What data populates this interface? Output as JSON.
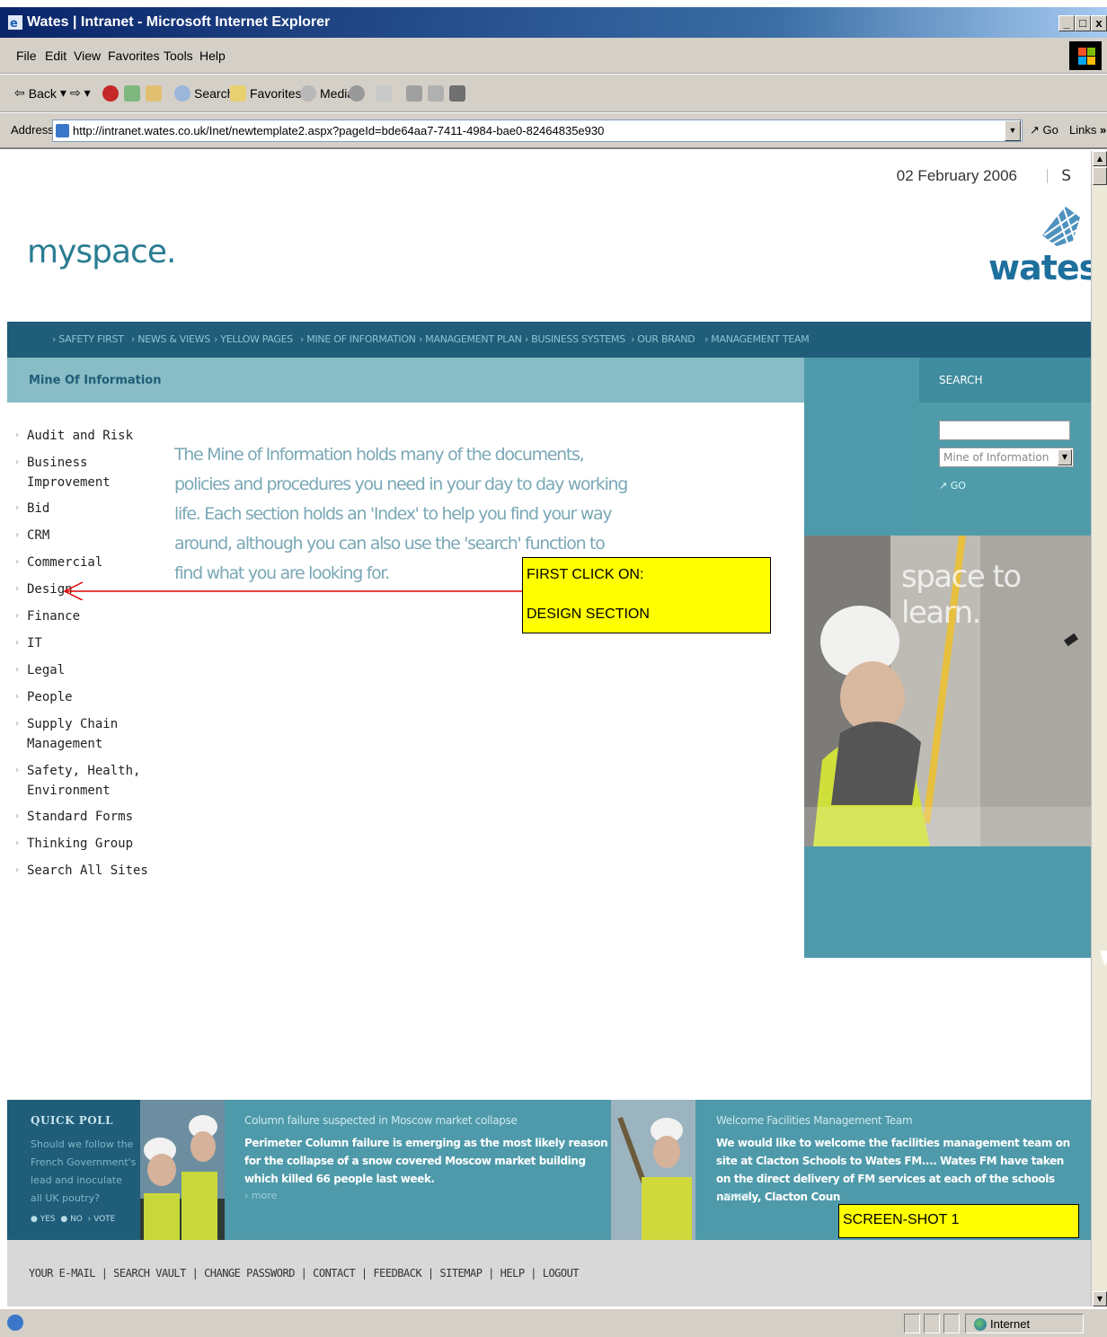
{
  "window": {
    "title": "Wates | Intranet - Microsoft Internet Explorer",
    "controls": [
      "_",
      "□",
      "x"
    ]
  },
  "menu": [
    "File",
    "Edit",
    "View",
    "Favorites",
    "Tools",
    "Help"
  ],
  "toolbar": {
    "back": "Back",
    "search": "Search",
    "favorites": "Favorites",
    "media": "Media"
  },
  "address": {
    "label": "Address",
    "url": "http://intranet.wates.co.uk/Inet/newtemplate2.aspx?pageId=bde64aa7-7411-4984-bae0-82464835e930",
    "go": "Go",
    "links": "Links"
  },
  "header": {
    "date": "02 February 2006",
    "s": "S",
    "logo_left": "myspace.",
    "logo_right": "wates"
  },
  "nav": [
    "› SAFETY FIRST",
    "› NEWS & VIEWS",
    "› YELLOW PAGES",
    "› MINE OF INFORMATION",
    "› MANAGEMENT PLAN",
    "› BUSINESS SYSTEMS",
    "› OUR BRAND",
    "› MANAGEMENT TEAM"
  ],
  "section": {
    "title": "Mine Of Information"
  },
  "search": {
    "label": "SEARCH",
    "input_value": "",
    "scope": "Mine of Information",
    "go": "GO"
  },
  "hero": {
    "text": "space to learn."
  },
  "sidebar": [
    {
      "label": "Audit and Risk",
      "label2": ""
    },
    {
      "label": "Business",
      "label2": "Improvement"
    },
    {
      "label": "Bid",
      "label2": ""
    },
    {
      "label": "CRM",
      "label2": ""
    },
    {
      "label": "Commercial",
      "label2": ""
    },
    {
      "label": "Design",
      "label2": ""
    },
    {
      "label": "Finance",
      "label2": ""
    },
    {
      "label": "IT",
      "label2": ""
    },
    {
      "label": "Legal",
      "label2": ""
    },
    {
      "label": "People",
      "label2": ""
    },
    {
      "label": "Supply Chain",
      "label2": "Management"
    },
    {
      "label": "Safety, Health,",
      "label2": "Environment"
    },
    {
      "label": "Standard Forms",
      "label2": ""
    },
    {
      "label": "Thinking Group",
      "label2": ""
    },
    {
      "label": "Search All Sites",
      "label2": ""
    }
  ],
  "intro": "The Mine of Information holds many of the documents, policies and procedures you need in your day to day working life. Each section holds an 'Index' to help you find your way around, although you can also use the 'search' function to find what you are looking for.",
  "callout": {
    "line1": "FIRST CLICK ON:",
    "line2": "DESIGN SECTION",
    "color": "#ffff00",
    "arrow_color": "#e00000"
  },
  "poll": {
    "heading": "QUICK POLL",
    "question": "Should we follow the French Government's lead and inoculate all UK poutry?",
    "yes": "YES",
    "no": "NO",
    "vote": "› VOTE"
  },
  "news": [
    {
      "heading": "Column failure suspected in Moscow market collapse",
      "body": "Perimeter Column failure is emerging as the most likely reason for the collapse of a snow covered Moscow market building which killed 66 people last week.",
      "more": "› more"
    },
    {
      "heading": "Welcome Facilities Management Team",
      "body": "We would like to welcome the facilities management team on site at Clacton Schools to Wates FM.... Wates FM have taken on the direct delivery of FM services at each of the schools namely, Clacton Coun",
      "more": "› more"
    }
  ],
  "screenshot_label": "SCREEN-SHOT 1",
  "footer": {
    "links": [
      "YOUR E-MAIL",
      "SEARCH VAULT",
      "CHANGE PASSWORD",
      "CONTACT",
      "FEEDBACK",
      "SITEMAP",
      "HELP",
      "LOGOUT"
    ]
  },
  "status": {
    "zone": "Internet"
  },
  "colors": {
    "brand_teal": "#4e9aaa",
    "nav_dark": "#1f5d78",
    "section_bar": "#88bcc6"
  }
}
